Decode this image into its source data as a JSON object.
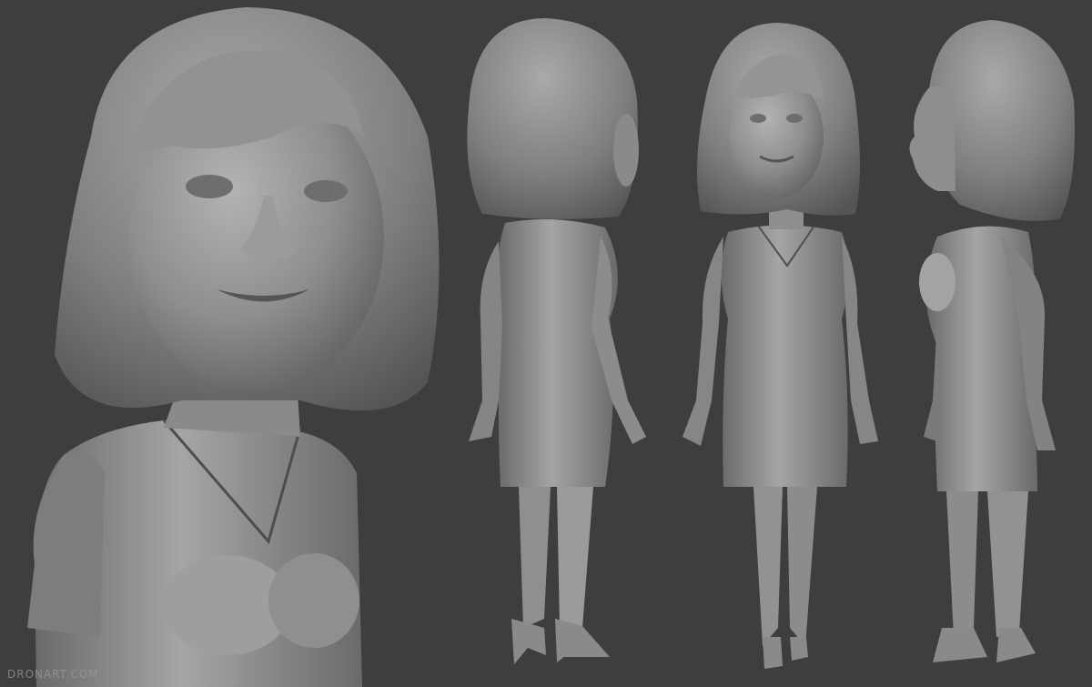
{
  "scene": {
    "background_color": "#3e3e3e",
    "clay_color": "#8c8c8c",
    "views": [
      "front-closeup",
      "back-three-quarter",
      "front",
      "side-profile"
    ]
  },
  "watermark": {
    "text": "DRONART.COM"
  }
}
